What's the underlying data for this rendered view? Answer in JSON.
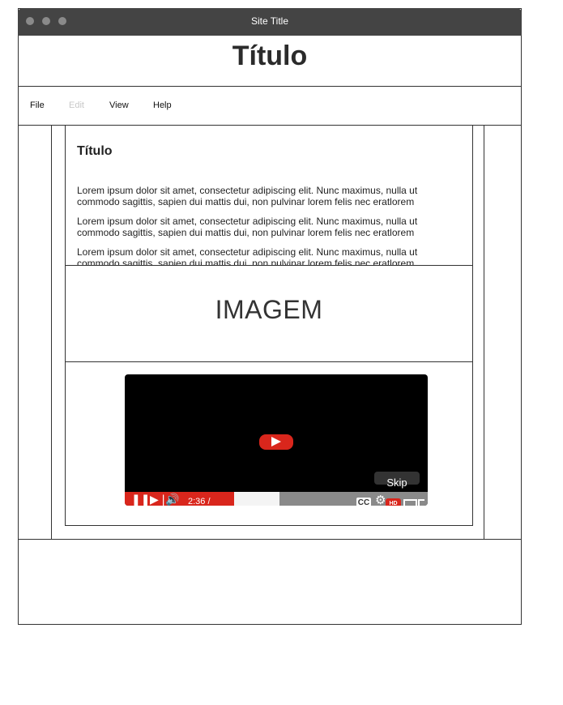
{
  "window": {
    "title": "Site Title"
  },
  "header": {
    "title": "Título"
  },
  "menu": {
    "file": "File",
    "edit": "Edit",
    "view": "View",
    "help": "Help"
  },
  "article": {
    "title": "Título",
    "p1": "Lorem ipsum dolor sit amet, consectetur adipiscing elit. Nunc maximus, nulla ut commodo sagittis, sapien dui mattis dui, non pulvinar lorem felis nec eratlorem",
    "p2": "Lorem ipsum dolor sit amet, consectetur adipiscing elit. Nunc maximus, nulla ut commodo sagittis, sapien dui mattis dui, non pulvinar lorem felis nec eratlorem",
    "p3": "Lorem ipsum dolor sit amet, consectetur adipiscing elit. Nunc maximus, nulla ut commodo sagittis, sapien dui mattis dui, non pulvinar lorem felis nec eratlorem"
  },
  "image": {
    "label": "IMAGEM"
  },
  "video": {
    "skip_label": "Skip",
    "time": "2:36 /",
    "cc_label": "CC",
    "hd_label": "HD",
    "progress_percent": 36,
    "buffered_percent": 51
  },
  "colors": {
    "accent": "#d9261c",
    "titlebar": "#444444",
    "border": "#333333"
  }
}
